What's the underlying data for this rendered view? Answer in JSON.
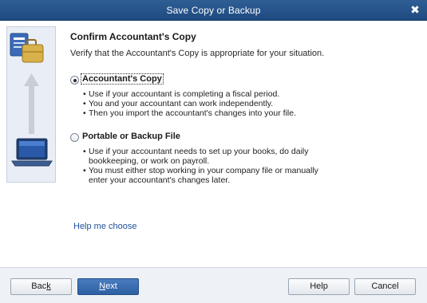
{
  "window": {
    "title": "Save Copy or Backup",
    "close_glyph": "✖"
  },
  "page": {
    "heading": "Confirm Accountant's Copy",
    "subtext": "Verify that the Accountant's Copy is appropriate for your situation."
  },
  "illustration": {
    "icons": [
      "office-files-icon",
      "briefcase-icon",
      "up-arrow-icon",
      "laptop-icon"
    ],
    "colors": {
      "panel": "#e9eef6",
      "briefcase": "#d9b14a",
      "screen": "#2a5aa7",
      "arrow": "#c9ced6"
    }
  },
  "options": [
    {
      "label": "Accountant's Copy",
      "selected": true,
      "bullets": [
        "Use if your accountant is completing a fiscal period.",
        "You and your accountant can work independently.",
        "Then you import the accountant's changes into your file."
      ]
    },
    {
      "label": "Portable or Backup File",
      "selected": false,
      "bullets": [
        "Use if your accountant needs to set up your books, do daily",
        "bookkeeping, or work on payroll.",
        "You must either stop working in your company file or manually",
        "enter your accountant's changes later."
      ]
    }
  ],
  "help_link": "Help me choose",
  "buttons": {
    "back": {
      "pre": "Bac",
      "underlined": "k",
      "post": ""
    },
    "next": {
      "pre": "",
      "underlined": "N",
      "post": "ext"
    },
    "help": "Help",
    "cancel": "Cancel"
  },
  "colors": {
    "titlebar": "#2f5e95",
    "primary_button": "#3a6db3",
    "link": "#1f4f9a"
  }
}
